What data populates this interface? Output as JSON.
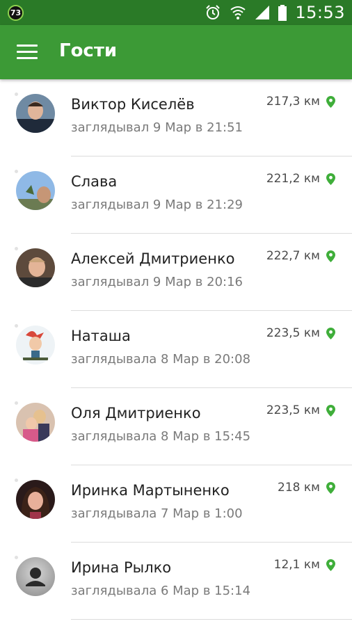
{
  "status_bar": {
    "badge": "73",
    "time": "15:53",
    "icons": [
      "alarm-icon",
      "wifi-icon",
      "signal-icon",
      "battery-icon"
    ]
  },
  "app_bar": {
    "title": "Гости",
    "menu_icon": "hamburger-menu-icon"
  },
  "colors": {
    "status_bar": "#2a7a27",
    "app_bar": "#3c9a36",
    "pin": "#3fae3a",
    "divider": "#dcdcdc"
  },
  "guests": [
    {
      "name": "Виктор Киселёв",
      "visit": "заглядывал 9 Мар в 21:51",
      "distance": "217,3 км"
    },
    {
      "name": "Слава",
      "visit": "заглядывал 9 Мар в 21:29",
      "distance": "221,2 км"
    },
    {
      "name": "Алексей Дмитриенко",
      "visit": "заглядывал 9 Мар в 20:16",
      "distance": "222,7 км"
    },
    {
      "name": "Наташа",
      "visit": "заглядывала 8 Мар в 20:08",
      "distance": "223,5 км"
    },
    {
      "name": "Оля Дмитриенко",
      "visit": "заглядывала 8 Мар в 15:45",
      "distance": "223,5 км"
    },
    {
      "name": "Иринка Мартыненко",
      "visit": "заглядывала 7 Мар в 1:00",
      "distance": "218 км"
    },
    {
      "name": "Ирина Рылко",
      "visit": "заглядывала 6 Мар в 15:14",
      "distance": "12,1 км"
    }
  ]
}
